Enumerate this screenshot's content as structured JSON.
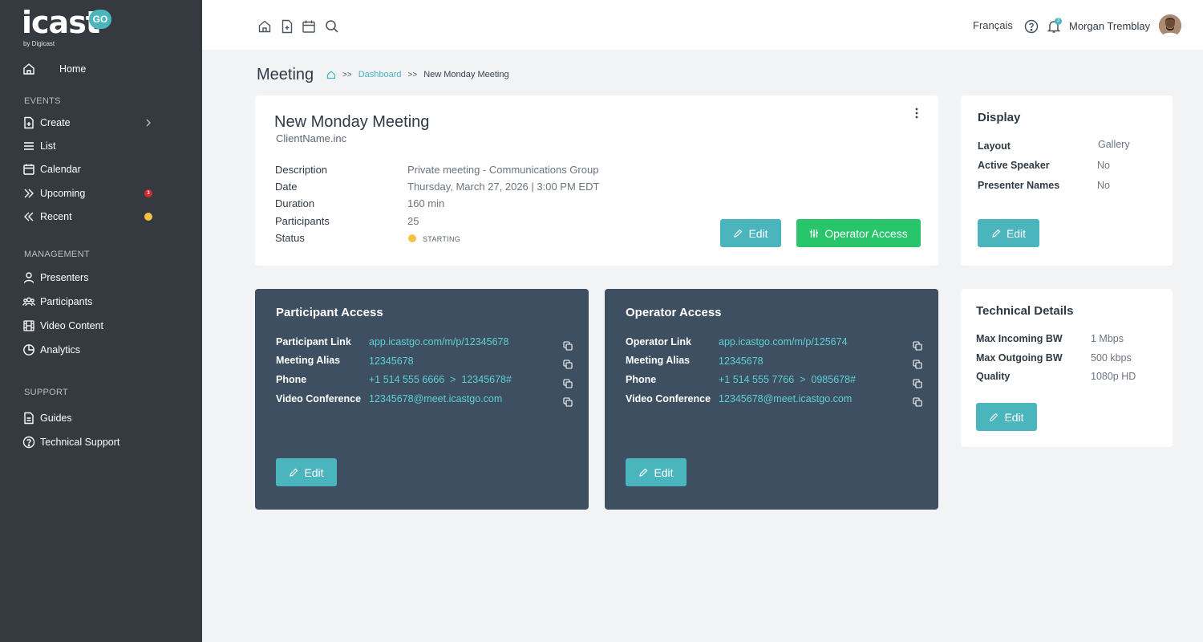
{
  "brand": {
    "name": "icast",
    "badge": "GO",
    "byline": "by Digicast"
  },
  "sidebar": {
    "home": "Home",
    "events_header": "EVENTS",
    "events": [
      {
        "label": "Create"
      },
      {
        "label": "List"
      },
      {
        "label": "Calendar"
      },
      {
        "label": "Upcoming",
        "badge": "3"
      },
      {
        "label": "Recent"
      }
    ],
    "management_header": "MANAGEMENT",
    "management": [
      {
        "label": "Presenters"
      },
      {
        "label": "Participants"
      },
      {
        "label": "Video Content"
      },
      {
        "label": "Analytics"
      }
    ],
    "support_header": "SUPPORT",
    "support": [
      {
        "label": "Guides"
      },
      {
        "label": "Technical Support"
      }
    ]
  },
  "topbar": {
    "language": "Français",
    "notifications_count": "3",
    "user_name": "Morgan Tremblay"
  },
  "page": {
    "title": "Meeting",
    "breadcrumb_link": "Dashboard",
    "breadcrumb_current": "New Monday Meeting"
  },
  "meeting": {
    "title": "New Monday Meeting",
    "client": "ClientName.inc",
    "labels": {
      "description": "Description",
      "date": "Date",
      "duration": "Duration",
      "participants": "Participants",
      "status": "Status"
    },
    "values": {
      "description": "Private meeting - Communications Group",
      "date": "Thursday, March 27, 2026 | 3:00 PM EDT",
      "duration": "160 min",
      "participants": "25",
      "status": "STARTING"
    },
    "edit_label": "Edit",
    "operator_label": "Operator Access"
  },
  "display": {
    "title": "Display",
    "layout_label": "Layout",
    "layout_value": "Gallery",
    "speaker_label": "Active Speaker",
    "speaker_value": "No",
    "presenter_label": "Presenter Names",
    "presenter_value": "No",
    "edit_label": "Edit"
  },
  "technical": {
    "title": "Technical Details",
    "incoming_label": "Max Incoming BW",
    "incoming_value": "1 Mbps",
    "outgoing_label": "Max Outgoing BW",
    "outgoing_value": "500 kbps",
    "quality_label": "Quality",
    "quality_value": "1080p HD",
    "edit_label": "Edit"
  },
  "participant_access": {
    "title": "Participant Access",
    "link_label": "Participant Link",
    "link_value": "app.icastgo.com/m/p/12345678",
    "alias_label": "Meeting Alias",
    "alias_value": "12345678",
    "phone_label": "Phone",
    "phone_value": "+1 514 555 6666  >  12345678#",
    "video_label": "Video Conference",
    "video_value": "12345678@meet.icastgo.com",
    "edit_label": "Edit"
  },
  "operator_access": {
    "title": "Operator Access",
    "link_label": "Operator Link",
    "link_value": "app.icastgo.com/m/p/125674",
    "alias_label": "Meeting Alias",
    "alias_value": "12345678",
    "phone_label": "Phone",
    "phone_value": "+1 514 555 7766  >  0985678#",
    "video_label": "Video Conference",
    "video_value": "12345678@meet.icastgo.com",
    "edit_label": "Edit"
  },
  "colors": {
    "sidebar": "#343a40",
    "accent": "#4ab5bd",
    "green": "#29c56b",
    "dark_card": "#3d4f60",
    "status_yellow": "#f5c242"
  }
}
